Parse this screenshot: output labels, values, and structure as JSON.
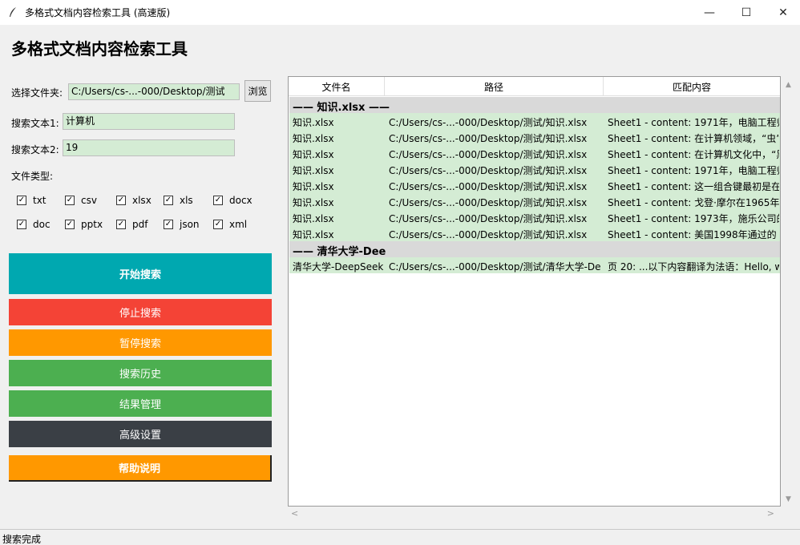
{
  "window": {
    "title": "多格式文档内容检索工具 (高速版)",
    "minimize": "—",
    "maximize": "☐",
    "close": "✕"
  },
  "header": {
    "title": "多格式文档内容检索工具"
  },
  "form": {
    "folder_label": "选择文件夹:",
    "folder_value": "C:/Users/cs-...-000/Desktop/测试",
    "browse_label": "浏览",
    "search1_label": "搜索文本1:",
    "search1_value": "计算机",
    "search2_label": "搜索文本2:",
    "search2_value": "19",
    "filetypes_label": "文件类型:"
  },
  "filetypes": [
    {
      "name": "txt",
      "checked": true,
      "mark": "✓"
    },
    {
      "name": "csv",
      "checked": true,
      "mark": "✓"
    },
    {
      "name": "xlsx",
      "checked": true,
      "mark": "✓"
    },
    {
      "name": "xls",
      "checked": true,
      "mark": "✓"
    },
    {
      "name": "docx",
      "checked": true,
      "mark": "✓"
    },
    {
      "name": "doc",
      "checked": true,
      "mark": "✓"
    },
    {
      "name": "pptx",
      "checked": true,
      "mark": "✓"
    },
    {
      "name": "pdf",
      "checked": true,
      "mark": "✓"
    },
    {
      "name": "json",
      "checked": true,
      "mark": "✓"
    },
    {
      "name": "xml",
      "checked": true,
      "mark": "✓"
    }
  ],
  "buttons": {
    "start": {
      "label": "开始搜索",
      "color": "#00a8b0"
    },
    "stop": {
      "label": "停止搜索",
      "color": "#f44336"
    },
    "pause": {
      "label": "暂停搜索",
      "color": "#ff9800"
    },
    "history": {
      "label": "搜索历史",
      "color": "#4caf50"
    },
    "results": {
      "label": "结果管理",
      "color": "#4caf50"
    },
    "advanced": {
      "label": "高级设置",
      "color": "#3a3f45"
    },
    "help": {
      "label": "帮助说明",
      "color": "#ff9800"
    }
  },
  "results": {
    "columns": [
      "文件名",
      "路径",
      "匹配内容"
    ],
    "groups": [
      {
        "header": "—— 知识.xlsx ——",
        "rows": [
          {
            "file": "知识.xlsx",
            "path": "C:/Users/cs-...-000/Desktop/测试/知识.xlsx",
            "match": "Sheet1 - content: 1971年，电脑工程师"
          },
          {
            "file": "知识.xlsx",
            "path": "C:/Users/cs-...-000/Desktop/测试/知识.xlsx",
            "match": "Sheet1 - content: 在计算机领域，“虫”"
          },
          {
            "file": "知识.xlsx",
            "path": "C:/Users/cs-...-000/Desktop/测试/知识.xlsx",
            "match": "Sheet1 - content: 在计算机文化中，“黑"
          },
          {
            "file": "知识.xlsx",
            "path": "C:/Users/cs-...-000/Desktop/测试/知识.xlsx",
            "match": "Sheet1 - content: 1971年，电脑工程师"
          },
          {
            "file": "知识.xlsx",
            "path": "C:/Users/cs-...-000/Desktop/测试/知识.xlsx",
            "match": "Sheet1 - content: 这一组合键最初是在"
          },
          {
            "file": "知识.xlsx",
            "path": "C:/Users/cs-...-000/Desktop/测试/知识.xlsx",
            "match": "Sheet1 - content: 戈登·摩尔在1965年预"
          },
          {
            "file": "知识.xlsx",
            "path": "C:/Users/cs-...-000/Desktop/测试/知识.xlsx",
            "match": "Sheet1 - content: 1973年，施乐公司的"
          },
          {
            "file": "知识.xlsx",
            "path": "C:/Users/cs-...-000/Desktop/测试/知识.xlsx",
            "match": "Sheet1 - content: 美国1998年通过的《"
          }
        ]
      },
      {
        "header": "—— 清华大学-Dee",
        "rows": [
          {
            "file": "清华大学-DeepSeek",
            "path": "C:/Users/cs-...-000/Desktop/测试/清华大学-De",
            "match": "页 20: ...以下内容翻译为法语：Hello, w"
          }
        ]
      }
    ]
  },
  "status": {
    "text": "搜索完成"
  }
}
